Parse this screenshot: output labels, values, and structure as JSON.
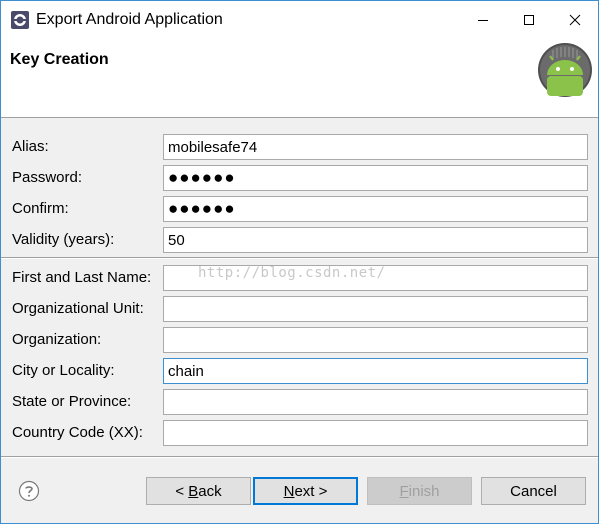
{
  "window": {
    "title": "Export Android Application",
    "controls": {
      "minimize": "minimize-icon",
      "maximize": "maximize-icon",
      "close": "close-icon"
    }
  },
  "header": {
    "title": "Key Creation",
    "logo": "android-logo"
  },
  "form": {
    "alias": {
      "label": "Alias:",
      "value": "mobilesafe74"
    },
    "password": {
      "label": "Password:",
      "value": "●●●●●●"
    },
    "confirm": {
      "label": "Confirm:",
      "value": "●●●●●●"
    },
    "validity": {
      "label": "Validity (years):",
      "value": "50"
    },
    "name": {
      "label": "First and Last Name:",
      "value": ""
    },
    "org_unit": {
      "label": "Organizational Unit:",
      "value": ""
    },
    "organization": {
      "label": "Organization:",
      "value": ""
    },
    "city": {
      "label": "City or Locality:",
      "value": "chain"
    },
    "state": {
      "label": "State or Province:",
      "value": ""
    },
    "country": {
      "label": "Country Code (XX):",
      "value": ""
    }
  },
  "watermark": "http://blog.csdn.net/",
  "footer": {
    "help": "help-icon",
    "back": {
      "pre": "< ",
      "mnemonic": "B",
      "post": "ack"
    },
    "next": {
      "mnemonic": "N",
      "post": "ext >"
    },
    "finish": {
      "mnemonic": "F",
      "post": "inish"
    },
    "cancel": "Cancel"
  },
  "colors": {
    "accent": "#3d8fd0",
    "android_green": "#8bc34a",
    "dialog_bg": "#f0f0f0"
  }
}
